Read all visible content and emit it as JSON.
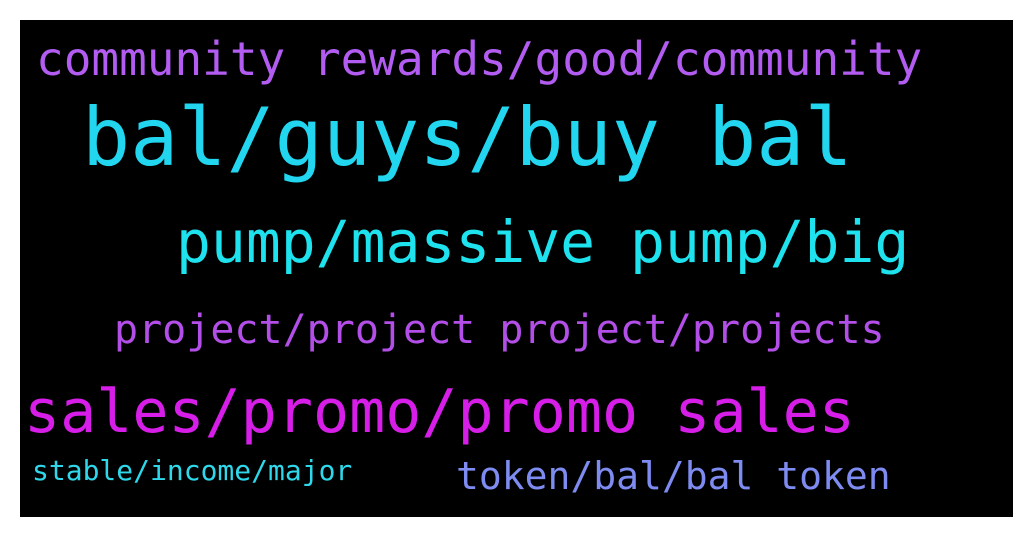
{
  "words": [
    {
      "text": "community rewards/good/community",
      "color": "#b35cf2"
    },
    {
      "text": "bal/guys/buy bal",
      "color": "#22d6f0"
    },
    {
      "text": "pump/massive pump/big",
      "color": "#1ee3ee"
    },
    {
      "text": "project/project project/projects",
      "color": "#b34fe8"
    },
    {
      "text": "sales/promo/promo sales",
      "color": "#d61ee8"
    },
    {
      "text": "stable/income/major",
      "color": "#2ed8ea"
    },
    {
      "text": "token/bal/bal token",
      "color": "#7e8bf0"
    }
  ]
}
